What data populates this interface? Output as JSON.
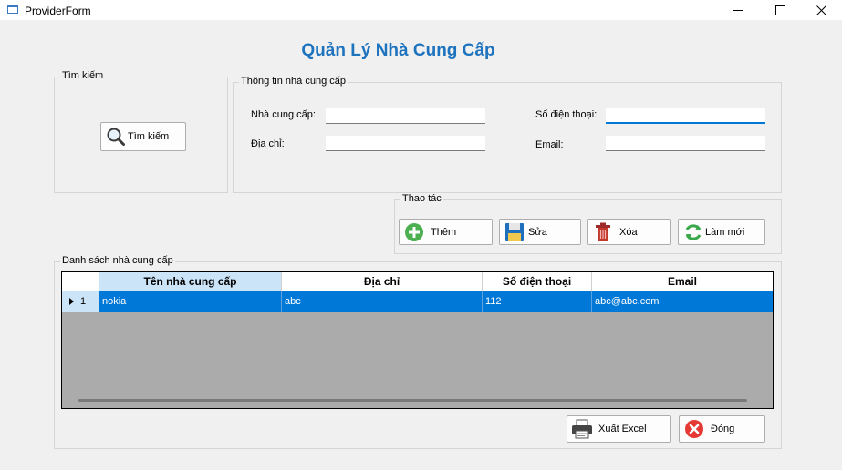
{
  "window": {
    "title": "ProviderForm"
  },
  "heading": "Quản Lý Nhà Cung Cấp",
  "search": {
    "group_label": "Tìm kiếm",
    "button_label": "Tìm kiếm"
  },
  "info": {
    "group_label": "Thông tin nhà cung cấp",
    "name_label": "Nhà cung cấp:",
    "name_value": "",
    "address_label": "Địa chỉ:",
    "address_value": "",
    "phone_label": "Số điện thoại:",
    "phone_value": "",
    "email_label": "Email:",
    "email_value": ""
  },
  "actions": {
    "group_label": "Thao tác",
    "add": "Thêm",
    "edit": "Sửa",
    "delete": "Xóa",
    "refresh": "Làm mới"
  },
  "list": {
    "group_label": "Danh sách nhà cung cấp",
    "columns": [
      "Tên nhà cung cấp",
      "Địa chỉ",
      "Số điện thoại",
      "Email"
    ],
    "rows": [
      {
        "index": "1",
        "name": "nokia",
        "address": "abc",
        "phone": "112",
        "email": "abc@abc.com"
      }
    ]
  },
  "footer": {
    "export": "Xuất Excel",
    "close": "Đóng"
  },
  "colors": {
    "accent": "#0078d7",
    "heading": "#1e73be",
    "selection_header": "#cce4f7"
  }
}
